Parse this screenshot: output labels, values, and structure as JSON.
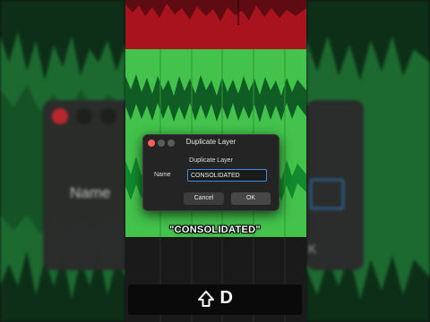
{
  "dialog": {
    "title": "Duplicate Layer",
    "heading": "Duplicate Layer",
    "name_label": "Name",
    "name_value": "CONSOLIDATED",
    "cancel_label": "Cancel",
    "ok_label": "OK",
    "traffic_colors": [
      "#ff5f57",
      "#5b5b5b",
      "#5b5b5b"
    ]
  },
  "caption": "\"CONSOLIDATED\"",
  "shortcut": {
    "icon": "shift-key-icon",
    "key": "D"
  },
  "background_left": {
    "label": "Name"
  },
  "background_right": {
    "label": "K"
  },
  "colors": {
    "red_track": "#a8131e",
    "green_track": "#42c24a",
    "accent_blue": "#3d8fd9"
  }
}
